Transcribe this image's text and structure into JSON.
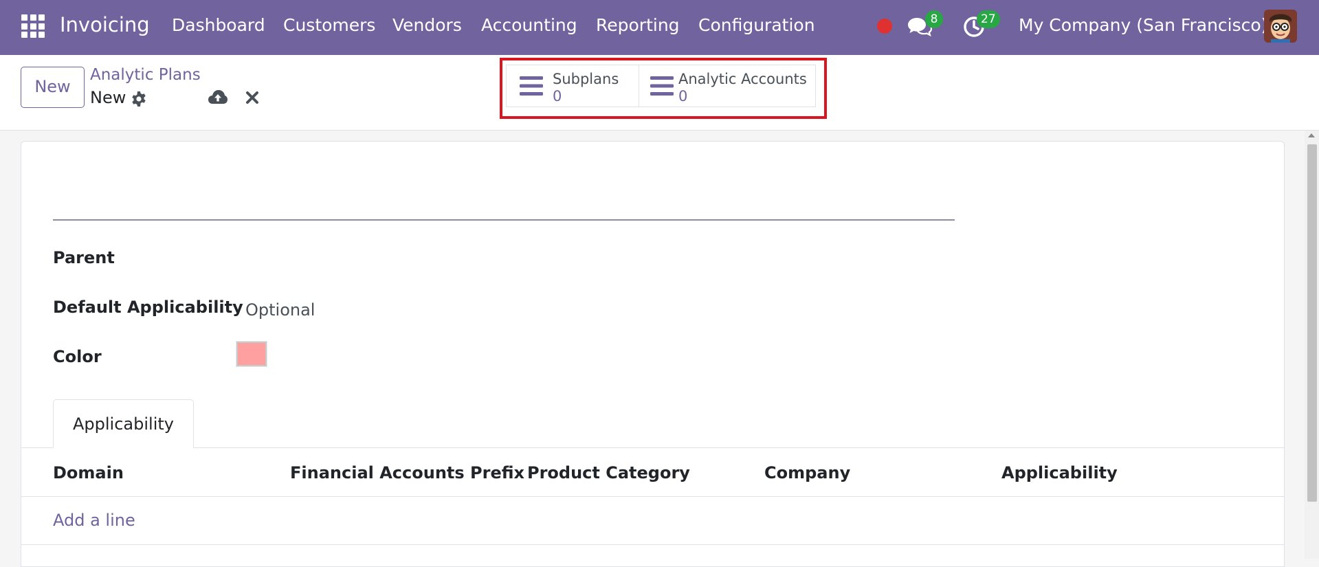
{
  "navbar": {
    "app_title": "Invoicing",
    "menu": [
      "Dashboard",
      "Customers",
      "Vendors",
      "Accounting",
      "Reporting",
      "Configuration"
    ],
    "messages_count": "8",
    "activities_count": "27",
    "company": "My Company (San Francisco)",
    "icons": [
      "apps-grid-icon",
      "record-dot-icon",
      "chat-icon",
      "clock-icon",
      "avatar"
    ],
    "accent_color": "#71639e"
  },
  "control_panel": {
    "new_label": "New",
    "breadcrumb_parent": "Analytic Plans",
    "breadcrumb_current": "New",
    "smart_buttons": [
      {
        "label": "Subplans",
        "value": "0",
        "icon": "list-icon"
      },
      {
        "label": "Analytic Accounts",
        "value": "0",
        "icon": "list-icon"
      }
    ],
    "highlight_color": "#d9161f"
  },
  "form": {
    "name_value": "",
    "fields": {
      "parent_label": "Parent",
      "parent_value": "",
      "applicability_label": "Default Applicability",
      "applicability_value": "Optional",
      "color_label": "Color",
      "color_value": "#ffa0a0"
    },
    "tabs": [
      "Applicability"
    ],
    "table": {
      "columns": [
        "Domain",
        "Financial Accounts Prefix",
        "Product Category",
        "Company",
        "Applicability"
      ],
      "add_line": "Add a line"
    }
  }
}
